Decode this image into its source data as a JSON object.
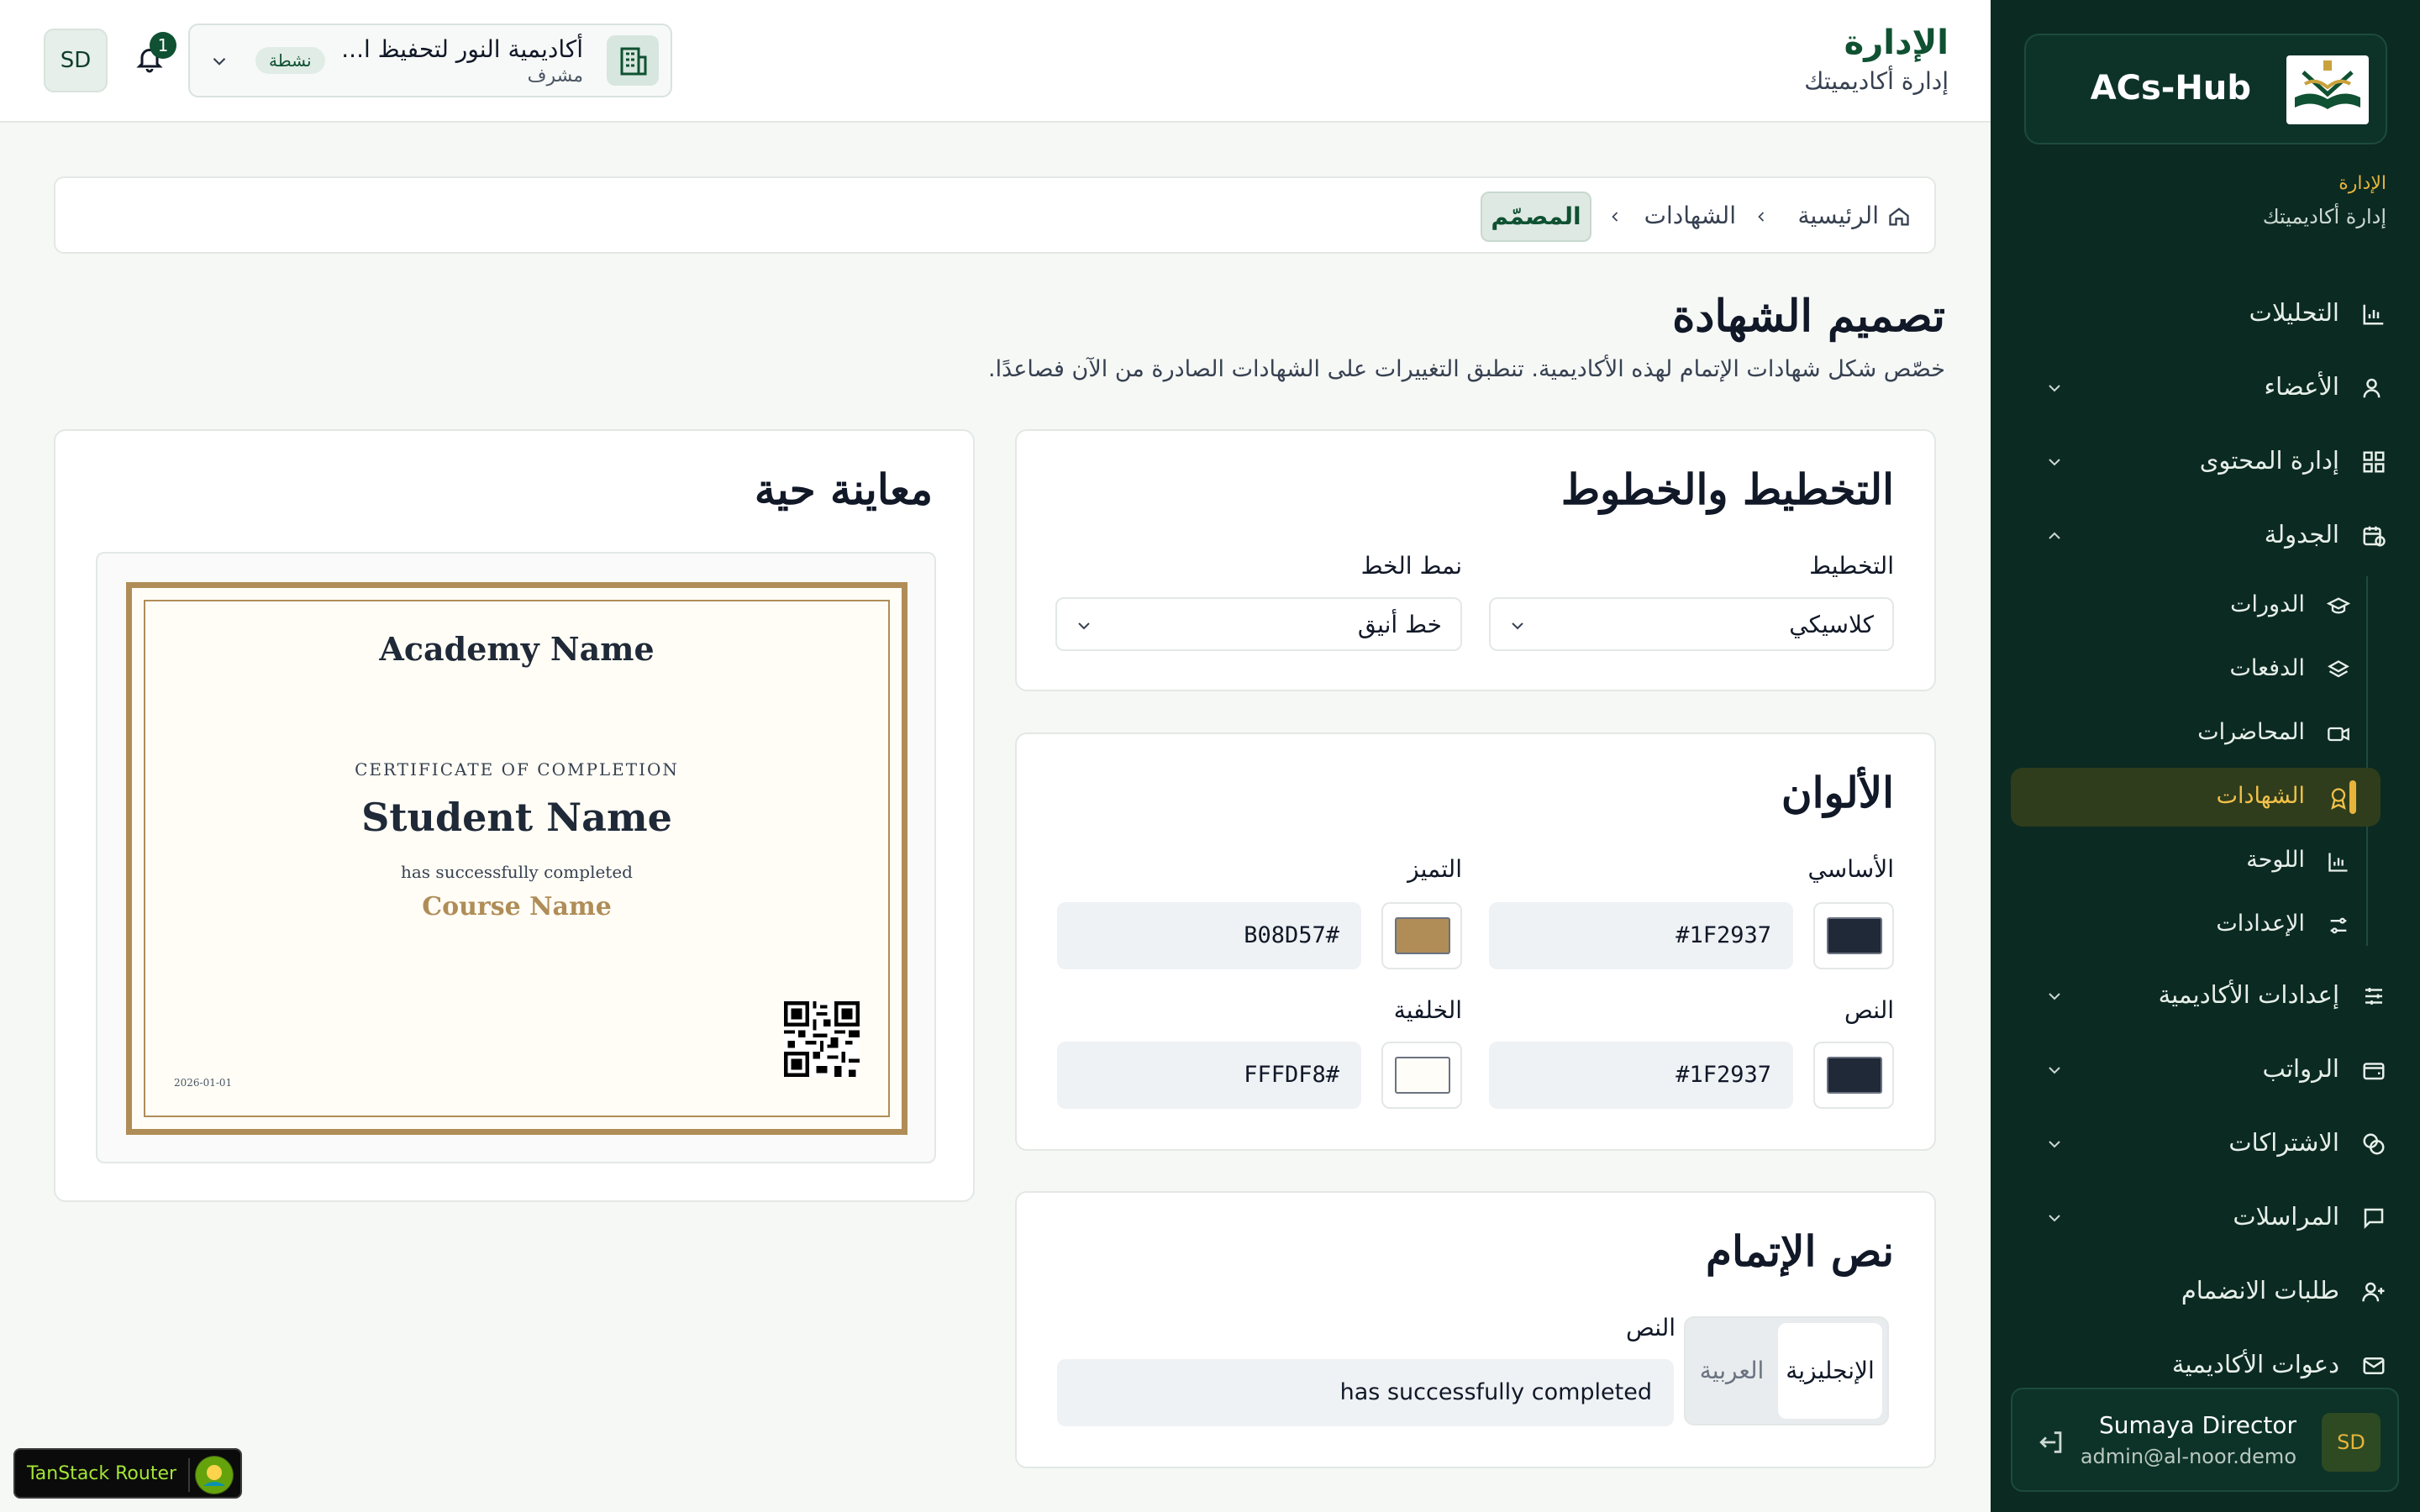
{
  "sidebar": {
    "brand": "ACs-Hub",
    "section_label": "الإدارة",
    "section_sub": "إدارة أكاديميتك",
    "items": [
      {
        "label": "التحليلات"
      },
      {
        "label": "الأعضاء"
      },
      {
        "label": "إدارة المحتوى"
      },
      {
        "label": "الجدولة"
      },
      {
        "label": "إعدادات الأكاديمية"
      },
      {
        "label": "الرواتب"
      },
      {
        "label": "الاشتراكات"
      },
      {
        "label": "المراسلات"
      },
      {
        "label": "طلبات الانضمام"
      },
      {
        "label": "دعوات الأكاديمية"
      }
    ],
    "sub_items": [
      {
        "label": "الدورات"
      },
      {
        "label": "الدفعات"
      },
      {
        "label": "المحاضرات"
      },
      {
        "label": "الشهادات"
      },
      {
        "label": "اللوحة"
      },
      {
        "label": "الإعدادات"
      }
    ],
    "user": {
      "initials": "SD",
      "name": "Sumaya Director",
      "email": "admin@al-noor.demo"
    }
  },
  "header": {
    "title": "الإدارة",
    "subtitle": "إدارة أكاديميتك",
    "avatar_initials": "SD",
    "notification_count": "1",
    "academy": {
      "name": "أكاديمية النور لتحفيظ ا...",
      "role": "مشرف",
      "status": "نشطة"
    }
  },
  "breadcrumb": {
    "home": "الرئيسية",
    "section": "الشهادات",
    "current": "المصمّم"
  },
  "page": {
    "title": "تصميم الشهادة",
    "description": "خصّص شكل شهادات الإتمام لهذه الأكاديمية. تنطبق التغييرات على الشهادات الصادرة من الآن فصاعدًا."
  },
  "layout_card": {
    "title": "التخطيط والخطوط",
    "layout_label": "التخطيط",
    "layout_value": "كلاسيكي",
    "font_label": "نمط الخط",
    "font_value": "خط أنيق"
  },
  "colors_card": {
    "title": "الألوان",
    "primary_label": "الأساسي",
    "primary_value": "#1F2937",
    "accent_label": "التميز",
    "accent_value": "#B08D57",
    "text_label": "النص",
    "text_value": "#1F2937",
    "background_label": "الخلفية",
    "background_value": "#FFFDF8"
  },
  "completion_card": {
    "title": "نص الإتمام",
    "tab_english": "الإنجليزية",
    "tab_arabic": "العربية",
    "text_label": "النص",
    "text_value": "has successfully completed"
  },
  "preview": {
    "title": "معاينة حية",
    "academy_name": "Academy Name",
    "certificate_heading": "CERTIFICATE OF COMPLETION",
    "student_name": "Student Name",
    "completed_text": "has successfully completed",
    "course_name": "Course Name",
    "date": "2026-01-01"
  },
  "devtools": {
    "label": "TanStack Router"
  },
  "colors": {
    "primary": "#1F2937",
    "accent": "#B08D57",
    "text": "#1F2937",
    "background": "#FFFDF8",
    "sidebar": "#0B2A22",
    "brand_green": "#0F5132",
    "highlight": "#E7B43A"
  }
}
